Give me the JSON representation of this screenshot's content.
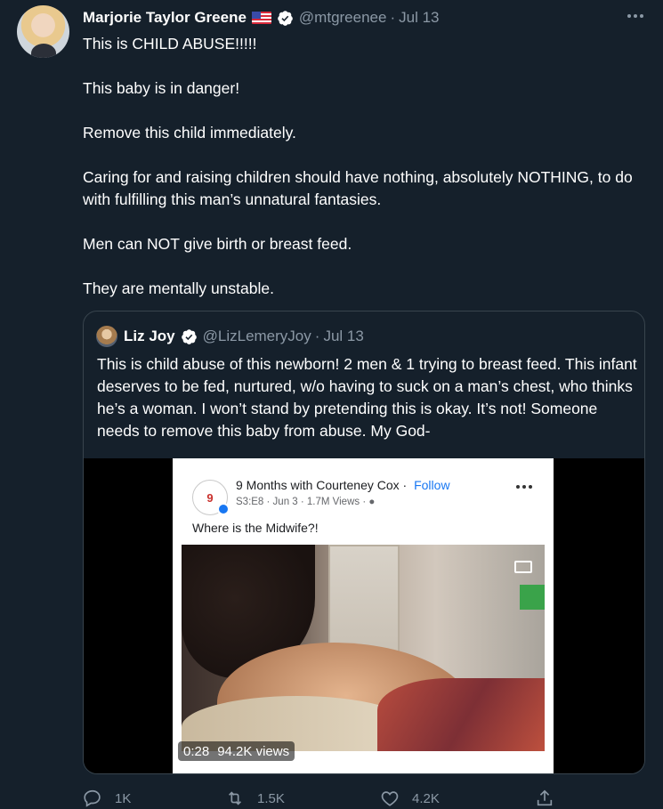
{
  "tweet": {
    "author_name": "Marjorie Taylor Greene",
    "flag_emoji": "us-flag-icon",
    "handle": "@mtgreenee",
    "separator": "·",
    "date": "Jul 13",
    "paragraphs": [
      "This is CHILD ABUSE!!!!!",
      "This baby is in danger!",
      "Remove this child immediately.",
      "Caring for and raising children should have nothing, absolutely NOTHING, to do with fulfilling this man’s unnatural fantasies.",
      "Men can NOT give birth or breast feed.",
      "They are mentally unstable."
    ]
  },
  "quote": {
    "author_name": "Liz Joy",
    "handle": "@LizLemeryJoy",
    "separator": "·",
    "date": "Jul 13",
    "text": "This is child abuse of this newborn! 2 men & 1 trying to breast feed. This infant deserves to be fed, nurtured, w/o having to suck on a man’s chest, who thinks he’s a woman. I won’t stand by pretending this is okay. It’s not! Someone needs to remove this baby from abuse. My God-",
    "video": {
      "fb_logo_text": "9",
      "fb_title": "9 Months with Courteney Cox",
      "fb_separator": "·",
      "fb_follow": "Follow",
      "fb_meta": "S3:E8 · Jun 3 · 1.7M Views ·",
      "fb_caption": "Where is the Midwife?!",
      "duration": "0:28",
      "views": "94.2K views"
    }
  },
  "actions": {
    "reply_count": "1K",
    "retweet_count": "1.5K",
    "like_count": "4.2K"
  },
  "colors": {
    "background": "#15202b",
    "text": "#ffffff",
    "muted": "#8b98a5",
    "border": "#38444d",
    "verified": "#ffffff",
    "link": "#1877f2"
  }
}
